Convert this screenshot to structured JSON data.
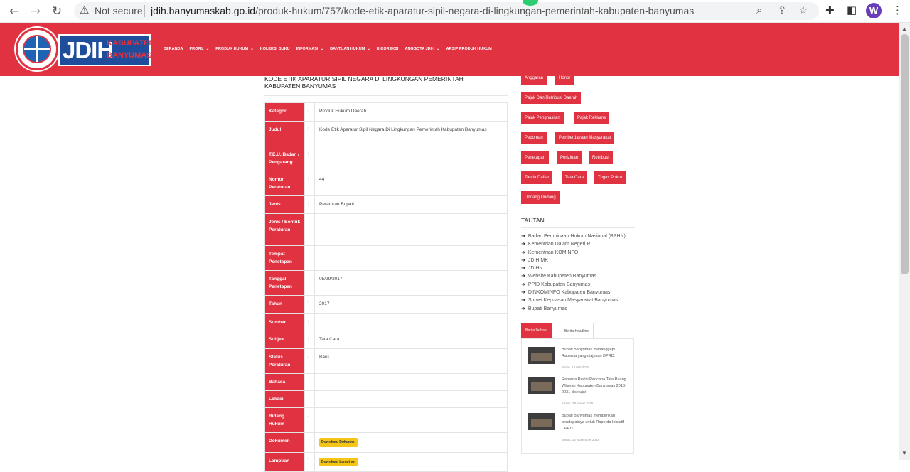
{
  "browser": {
    "security_label": "Not secure",
    "url_domain": "jdih.banyumaskab.go.id",
    "url_path": "/produk-hukum/757/kode-etik-aparatur-sipil-negara-di-lingkungan-pemerintah-kabupaten-banyumas",
    "profile_initial": "W"
  },
  "header": {
    "logo_main": "JDIH",
    "logo_line1": "KABUPATEN",
    "logo_line2": "BANYUMAS",
    "menu": [
      {
        "label": "BERANDA",
        "caret": ""
      },
      {
        "label": "PROFIL",
        "caret": "⌄"
      },
      {
        "label": "PRODUK HUKUM",
        "caret": "⌄"
      },
      {
        "label": "KOLEKSI BUKU",
        "caret": ""
      },
      {
        "label": "INFORMASI",
        "caret": "⌄"
      },
      {
        "label": "BANTUAN HUKUM",
        "caret": "⌄"
      },
      {
        "label": "E-KOREKSI",
        "caret": ""
      },
      {
        "label": "ANGGOTA JDIH",
        "caret": "⌄"
      },
      {
        "label": "ARSIP PRODUK HUKUM",
        "caret": ""
      }
    ]
  },
  "main": {
    "title": "KODE ETIK APARATUR SIPIL NEGARA DI LINGKUNGAN PEMERINTAH KABUPATEN BANYUMAS",
    "colon": ":",
    "rows": [
      {
        "key": "Kategori",
        "value": "Produk Hukum Daerah"
      },
      {
        "key": "Judul",
        "value": "Kode Etik Aparatur Sipil Negara Di Lingkungan Pemerintah Kabupaten Banyumas"
      },
      {
        "key": "T.E.U. Badan / Pengarang",
        "value": ""
      },
      {
        "key": "Nomor Peraturan",
        "value": "44"
      },
      {
        "key": "Jenis",
        "value": "Peraturan Bupati"
      },
      {
        "key": "Jenis / Bentuk Peraturan",
        "value": ""
      },
      {
        "key": "Tempat Penetapan",
        "value": ""
      },
      {
        "key": "Tanggal Penetapan",
        "value": "05/29/2017"
      },
      {
        "key": "Tahun",
        "value": "2017"
      },
      {
        "key": "Sumber",
        "value": ""
      },
      {
        "key": "Subjek",
        "value": "Tata Cara"
      },
      {
        "key": "Status Peraturan",
        "value": "Baru"
      },
      {
        "key": "Bahasa",
        "value": ""
      },
      {
        "key": "Lokasi",
        "value": ""
      },
      {
        "key": "Bidang Hukum",
        "value": ""
      },
      {
        "key": "Dokumen",
        "value": "Download Dokumen"
      },
      {
        "key": "Lampiran",
        "value": "Download Lampiran"
      }
    ]
  },
  "sidebar": {
    "tags": [
      "Anggaran",
      "Honor",
      "Pajak Dan Retribusi Daerah",
      "Pajak Penghasilan",
      "Pajak Reklame",
      "Pedoman",
      "Pemberdayaan Masyarakat",
      "Penetapan",
      "Perizinan",
      "Retribusi",
      "Tanda Daftar",
      "Tata Cara",
      "Tugas Pokok",
      "Undang Undang"
    ],
    "tautan_title": "TAUTAN",
    "links": [
      "Badan Pembinaan Hukum Nasional (BPHN)",
      "Kementrian Dalam Negeri RI",
      "Kementrian KOMINFO",
      "JDIH MK",
      "JDIHN",
      "Website Kabupaten Banyumas",
      "PPID Kabupaten Banyumas",
      "DINKOMINFO Kabupaten Banyumas",
      "Survei Kepuasan Masyarakat Banyumas",
      "Bupati Banyumas"
    ],
    "news_tabs": [
      "Berita Terbaru",
      "Berita Headline"
    ],
    "news": [
      {
        "title": "Bupati Banyumas menanggapi Raperda yang diajukan DPRD.",
        "date": "Senin, 13 Mei 2019"
      },
      {
        "title": "Raperda Revisi Rencana Tata Ruang Wilayah Kabupaten Banyumas 2018-2031 disetujui",
        "date": "Kamis, 28 Maret 2019"
      },
      {
        "title": "Bupati Banyumas memberikan pendapatnya untuk Raperda Inisiatif DPRD.",
        "date": "Jumat, 16 November 2018"
      }
    ]
  }
}
